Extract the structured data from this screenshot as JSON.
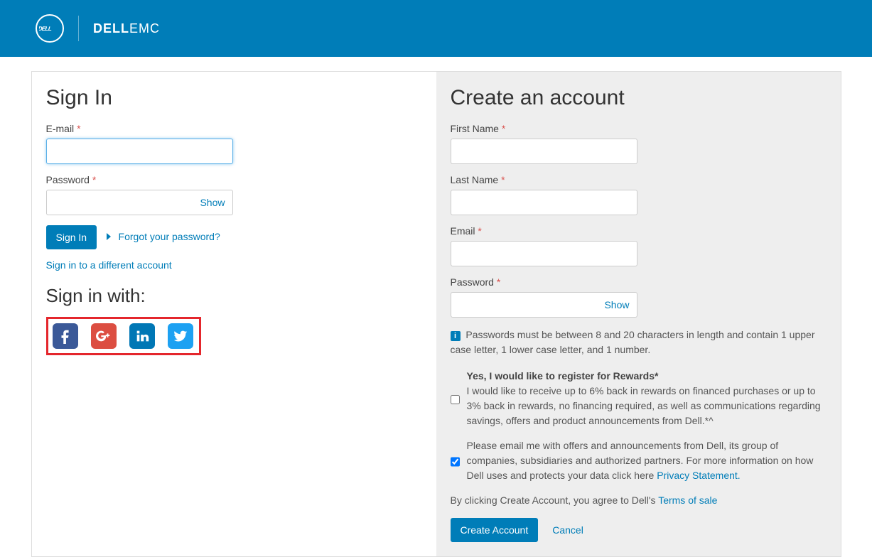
{
  "signin": {
    "title": "Sign In",
    "email_label": "E-mail",
    "password_label": "Password",
    "show_label": "Show",
    "signin_button": "Sign In",
    "forgot_link": "Forgot your password?",
    "different_account_link": "Sign in to a different account",
    "social_heading": "Sign in with:"
  },
  "create": {
    "title": "Create an account",
    "first_name_label": "First Name",
    "last_name_label": "Last Name",
    "email_label": "Email",
    "password_label": "Password",
    "show_label": "Show",
    "password_hint": "Passwords must be between 8 and 20 characters in length and contain 1 upper case letter, 1 lower case letter, and 1 number.",
    "rewards_label": "Yes, I would like to register for Rewards*",
    "rewards_desc": "I would like to receive up to 6% back in rewards on financed purchases or up to 3% back in rewards, no financing required, as well as communications regarding savings, offers and product announcements from Dell.*^",
    "offers_label": "Please email me with offers and announcements from Dell, its group of companies, subsidiaries and authorized partners. For more information on how Dell uses and protects your data click here ",
    "privacy_link": "Privacy Statement.",
    "agree_text": "By clicking Create Account, you agree to Dell's ",
    "terms_link": "Terms of sale",
    "create_button": "Create Account",
    "cancel_link": "Cancel"
  }
}
